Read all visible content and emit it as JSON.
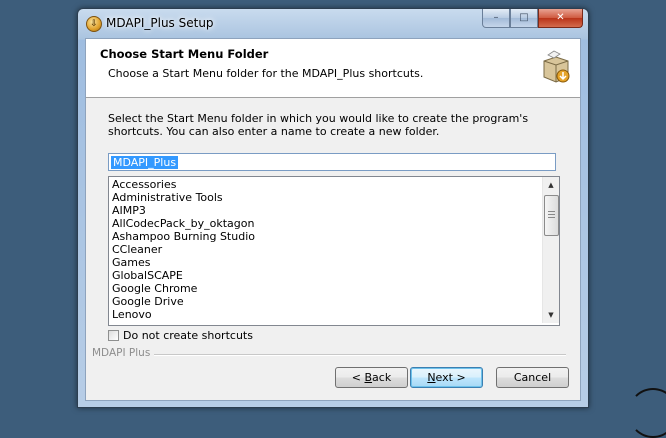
{
  "window": {
    "title": "MDAPI_Plus Setup",
    "app_icon_glyph": "⇩",
    "controls": {
      "minimize": "–",
      "maximize": "□",
      "close": "✕"
    }
  },
  "header": {
    "title": "Choose Start Menu Folder",
    "subtitle": "Choose a Start Menu folder for the MDAPI_Plus shortcuts.",
    "icon": "installer-box-icon"
  },
  "body": {
    "instructions": "Select the Start Menu folder in which you would like to create the program's shortcuts. You can also enter a name to create a new folder."
  },
  "folder_input": {
    "value": "MDAPI_Plus"
  },
  "folder_list": {
    "items": [
      "Accessories",
      "Administrative Tools",
      "AIMP3",
      "AllCodecPack_by_oktagon",
      "Ashampoo Burning Studio",
      "CCleaner",
      "Games",
      "GlobalSCAPE",
      "Google Chrome",
      "Google Drive",
      "Lenovo"
    ]
  },
  "checkbox": {
    "label": "Do not create shortcuts",
    "checked": false
  },
  "branding": {
    "text": "MDAPI Plus"
  },
  "buttons": {
    "back_prefix": "< ",
    "back_mnemonic": "B",
    "back_rest": "ack",
    "next_mnemonic": "N",
    "next_rest": "ext >",
    "cancel": "Cancel"
  },
  "colors": {
    "selection": "#3399ff",
    "desktop": "#3d5d7b",
    "close_button": "#c7482a"
  }
}
